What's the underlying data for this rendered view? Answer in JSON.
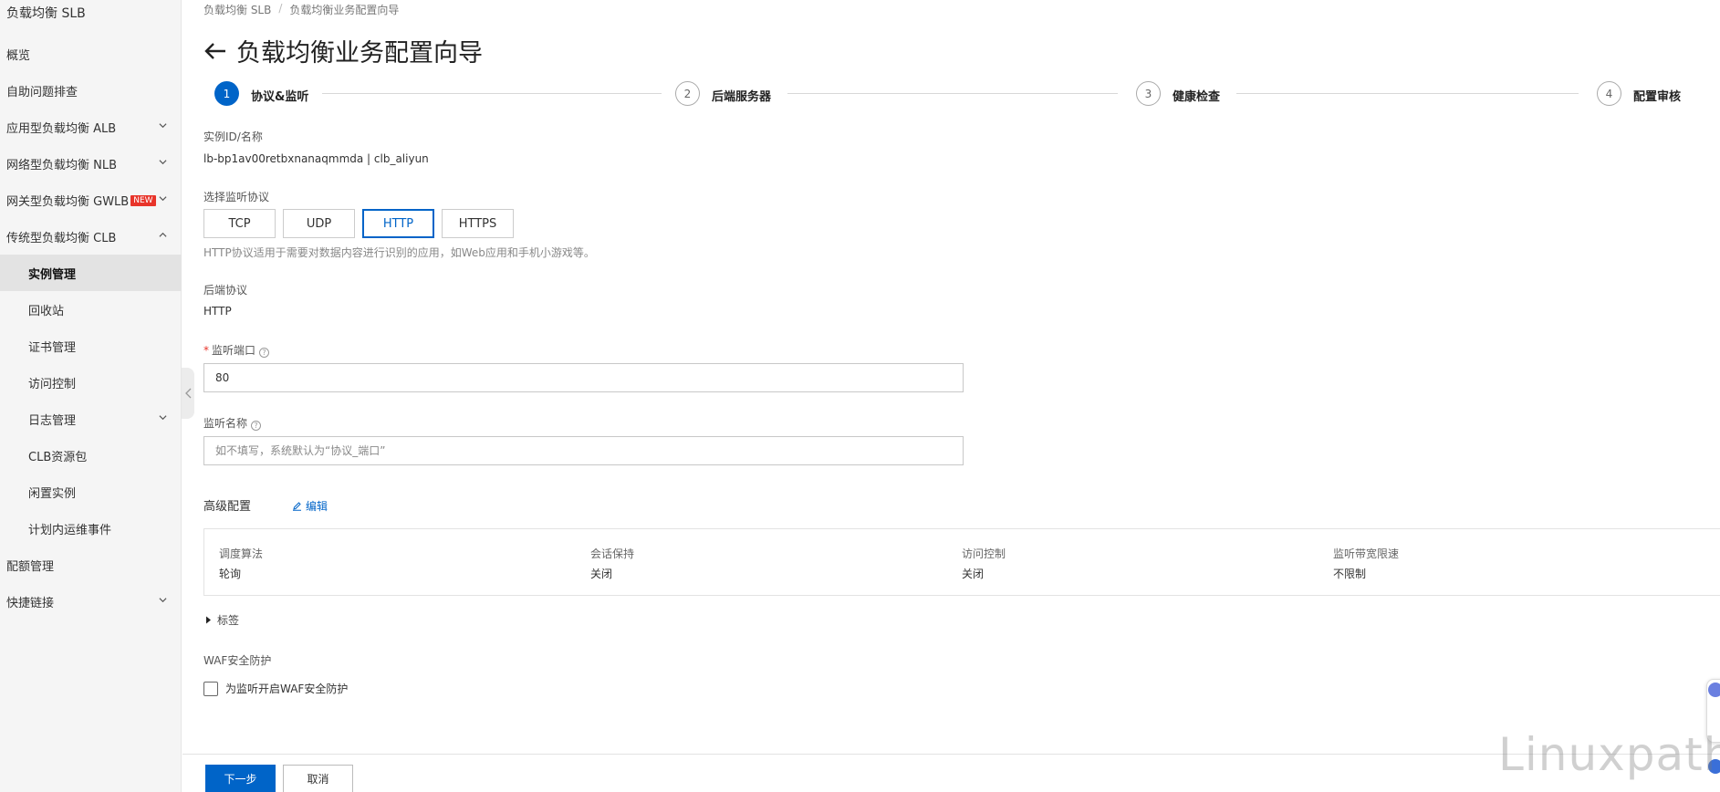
{
  "sidebar": {
    "title": "负载均衡 SLB",
    "items": [
      {
        "label": "概览",
        "sub": false,
        "chevron": ""
      },
      {
        "label": "自助问题排查",
        "sub": false,
        "chevron": ""
      },
      {
        "label": "应用型负载均衡 ALB",
        "sub": false,
        "chevron": "down"
      },
      {
        "label": "网络型负载均衡 NLB",
        "sub": false,
        "chevron": "down"
      },
      {
        "label": "网关型负载均衡 GWLB",
        "sub": false,
        "chevron": "down",
        "badge": "NEW"
      },
      {
        "label": "传统型负载均衡 CLB",
        "sub": false,
        "chevron": "up"
      },
      {
        "label": "实例管理",
        "sub": true,
        "active": true
      },
      {
        "label": "回收站",
        "sub": true
      },
      {
        "label": "证书管理",
        "sub": true
      },
      {
        "label": "访问控制",
        "sub": true
      },
      {
        "label": "日志管理",
        "sub": true,
        "chevron": "down"
      },
      {
        "label": "CLB资源包",
        "sub": true
      },
      {
        "label": "闲置实例",
        "sub": true
      },
      {
        "label": "计划内运维事件",
        "sub": true
      },
      {
        "label": "配额管理",
        "sub": false
      },
      {
        "label": "快捷链接",
        "sub": false,
        "chevron": "down"
      }
    ]
  },
  "breadcrumb": {
    "root": "负载均衡 SLB",
    "separator": "/",
    "current": "负载均衡业务配置向导"
  },
  "page": {
    "title": "负载均衡业务配置向导"
  },
  "steps": [
    {
      "number": "1",
      "label": "协议&监听",
      "state": "current"
    },
    {
      "number": "2",
      "label": "后端服务器",
      "state": "todo"
    },
    {
      "number": "3",
      "label": "健康检查",
      "state": "todo"
    },
    {
      "number": "4",
      "label": "配置审核",
      "state": "todo"
    }
  ],
  "form": {
    "instance_label": "实例ID/名称",
    "instance_value": "lb-bp1av00retbxnanaqmmda | clb_aliyun",
    "protocol_label": "选择监听协议",
    "protocols": [
      "TCP",
      "UDP",
      "HTTP",
      "HTTPS"
    ],
    "protocol_selected": "HTTP",
    "protocol_help": "HTTP协议适用于需要对数据内容进行识别的应用，如Web应用和手机小游戏等。",
    "backend_label": "后端协议",
    "backend_value": "HTTP",
    "port_required_mark": "*",
    "port_label": "监听端口",
    "port_value": "80",
    "name_label": "监听名称",
    "name_placeholder": "如不填写，系统默认为“协议_端口”"
  },
  "advanced": {
    "title": "高级配置",
    "edit_label": "编辑",
    "fields": [
      {
        "key": "调度算法",
        "value": "轮询"
      },
      {
        "key": "会话保持",
        "value": "关闭"
      },
      {
        "key": "访问控制",
        "value": "关闭"
      },
      {
        "key": "监听带宽限速",
        "value": "不限制"
      }
    ]
  },
  "tags": {
    "label": "标签"
  },
  "waf": {
    "title": "WAF安全防护",
    "checkbox_label": "为监听开启WAF安全防护",
    "checked": false
  },
  "footer": {
    "next_label": "下一步",
    "cancel_label": "取消"
  },
  "watermark": "Linuxpath",
  "colors": {
    "primary": "#0064c8",
    "badge": "#e8342a"
  }
}
